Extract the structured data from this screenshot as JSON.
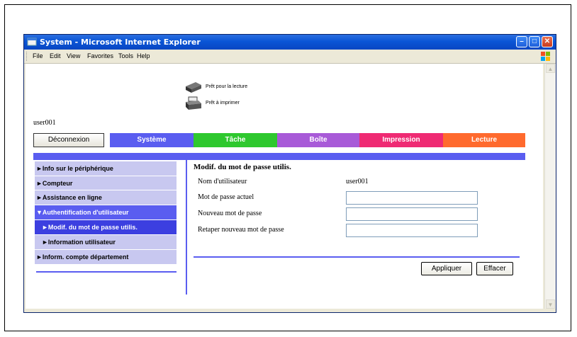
{
  "window": {
    "title": "System - Microsoft Internet Explorer"
  },
  "menubar": [
    "File",
    "Edit",
    "View",
    "Favorites",
    "Tools",
    "Help"
  ],
  "status": {
    "scanner": "Prêt pour la lecture",
    "printer": "Prêt à imprimer"
  },
  "user": "user001",
  "nav": {
    "logout": "Déconnexion",
    "tabs": [
      {
        "label": "Système",
        "color": "#5a5df0"
      },
      {
        "label": "Tâche",
        "color": "#2ec82e"
      },
      {
        "label": "Boîte",
        "color": "#a85ad8"
      },
      {
        "label": "Impression",
        "color": "#ef2a73"
      },
      {
        "label": "Lecture",
        "color": "#ff6a2e"
      }
    ]
  },
  "sidebar": {
    "items": [
      {
        "label": "►Info sur le périphérique"
      },
      {
        "label": "►Compteur"
      },
      {
        "label": "►Assistance en ligne"
      },
      {
        "label": "▼Authentification d'utilisateur"
      },
      {
        "label": "►Modif. du mot de passe utilis."
      },
      {
        "label": "►Information utilisateur"
      },
      {
        "label": "►Inform. compte département"
      }
    ]
  },
  "form": {
    "title": "Modif. du mot de passe utilis.",
    "username_label": "Nom d'utilisateur",
    "username_value": "user001",
    "current_label": "Mot de passe actuel",
    "new_label": "Nouveau mot de passe",
    "retype_label": "Retaper nouveau mot de passe",
    "current_value": "",
    "new_value": "",
    "retype_value": ""
  },
  "buttons": {
    "apply": "Appliquer",
    "clear": "Effacer"
  },
  "colors": {
    "accent": "#5a5df0",
    "sidebar_bg": "#c8c8f0"
  }
}
